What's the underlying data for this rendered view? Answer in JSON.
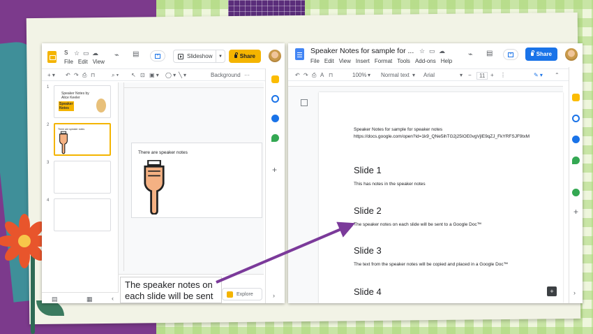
{
  "slides_app": {
    "title": "S",
    "menu": [
      "File",
      "Edit",
      "View"
    ],
    "slideshow_label": "Slideshow",
    "share_label": "Share",
    "toolbar_background": "Background",
    "thumbnails": [
      {
        "num": "1",
        "title": "Speaker Notes by Alice Keeler",
        "badge": "Speaker Notes"
      },
      {
        "num": "2",
        "text": "There are speaker notes"
      },
      {
        "num": "3"
      },
      {
        "num": "4"
      }
    ],
    "current_slide_text": "There are speaker notes",
    "explore_label": "Explore"
  },
  "callout": {
    "line1": "The speaker notes on",
    "line2": "each slide will be sent"
  },
  "docs_app": {
    "title": "Speaker Notes for sample for ...",
    "menu": [
      "File",
      "Edit",
      "View",
      "Insert",
      "Format",
      "Tools",
      "Add-ons",
      "Help"
    ],
    "share_label": "Share",
    "toolbar": {
      "zoom": "100%",
      "style": "Normal text",
      "font": "Arial",
      "size": "11"
    },
    "content": {
      "heading_line": "Speaker Notes for sample for speaker notes",
      "url": "https://docs.google.com/open?id=1k9_QNe5ihTG2j25IOE0vgVjlE9qZJ_FkYRFSJF9txM",
      "slides": [
        {
          "title": "Slide 1",
          "text": "This has notes in the speaker notes"
        },
        {
          "title": "Slide 2",
          "text": "The speaker notes on each slide will be sent to a Google Doc™"
        },
        {
          "title": "Slide 3",
          "text": "The text from the speaker notes will be copied and placed in a Google Doc™"
        },
        {
          "title": "Slide 4",
          "text": ""
        }
      ]
    }
  },
  "colors": {
    "slides_yellow": "#f4b400",
    "docs_blue": "#1a73e8",
    "arrow": "#7b3a9a"
  }
}
